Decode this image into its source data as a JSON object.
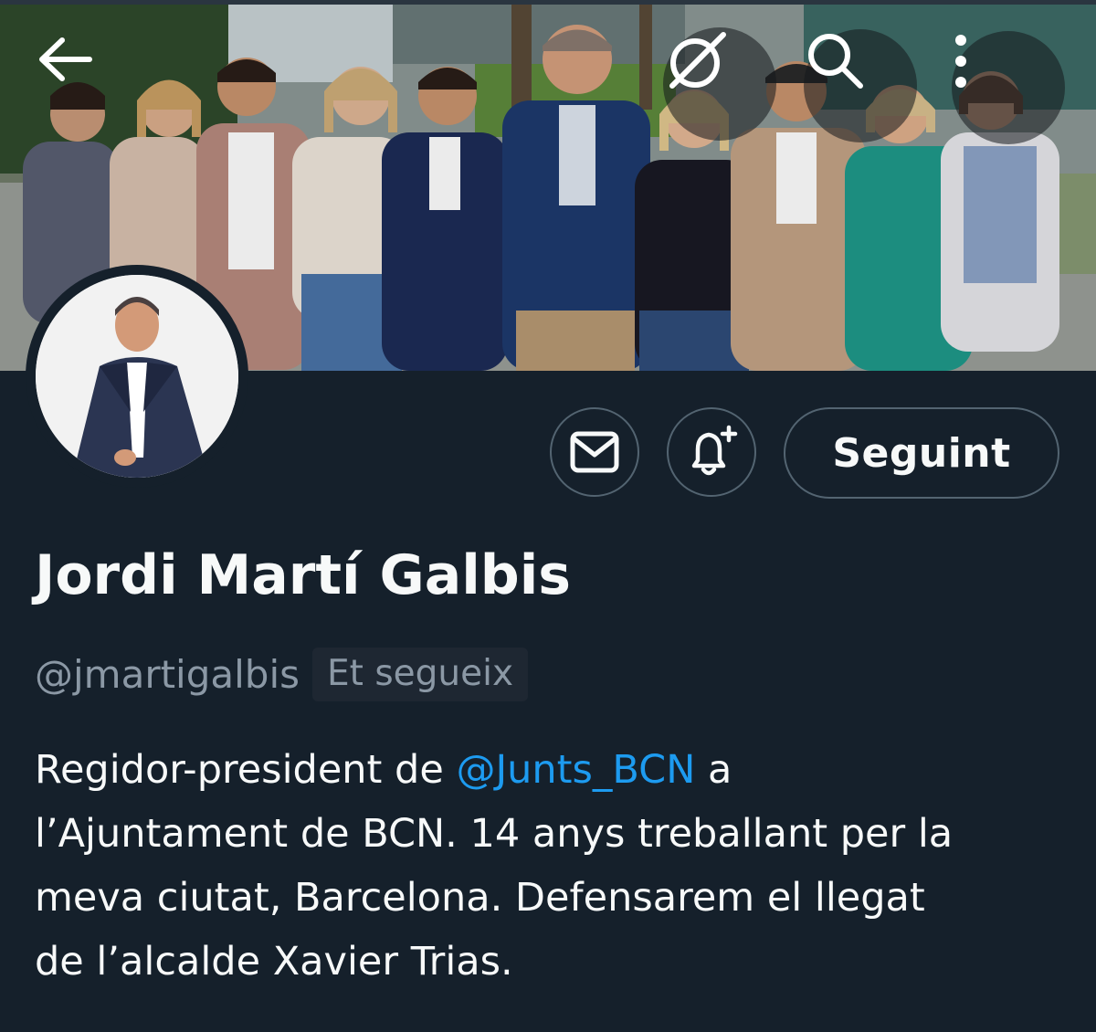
{
  "header": {
    "back_icon": "arrow-left-icon",
    "grok_icon": "grok-icon",
    "search_icon": "search-icon",
    "more_icon": "more-vertical-icon"
  },
  "profile": {
    "name": "Jordi Martí Galbis",
    "handle": "@jmartigalbis",
    "follows_you_badge": "Et segueix",
    "bio": {
      "line1_before": "Regidor-president de ",
      "line1_mention": "@Junts_BCN",
      "line1_after": " a",
      "line2": "l’Ajuntament de BCN. 14 anys treballant per la",
      "line3": "meva ciutat, Barcelona. Defensarem el llegat",
      "line4": "de l’alcalde Xavier Trias."
    }
  },
  "actions": {
    "message_icon": "envelope-icon",
    "notify_icon": "bell-plus-icon",
    "follow_label": "Seguint"
  },
  "colors": {
    "background": "#15202b",
    "text_primary": "#f7f9f9",
    "text_secondary": "#8b98a5",
    "accent": "#1d9bf0",
    "border": "#536471"
  }
}
